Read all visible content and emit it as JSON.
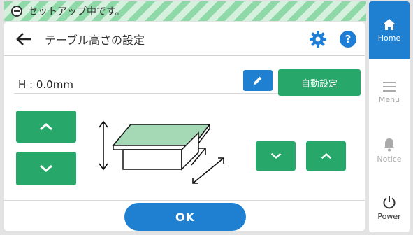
{
  "status": {
    "text": "セットアップ中です。"
  },
  "header": {
    "title": "テーブル高さの設定",
    "help_label": "?"
  },
  "height": {
    "label": "H : 0.0mm"
  },
  "buttons": {
    "auto_set": "自動設定",
    "ok": "OK"
  },
  "nav": {
    "home": "Home",
    "menu": "Menu",
    "notice": "Notice",
    "power": "Power"
  },
  "colors": {
    "accent_blue": "#1f7fd1",
    "accent_green": "#27a86a",
    "table_top": "#a5d8b4"
  }
}
